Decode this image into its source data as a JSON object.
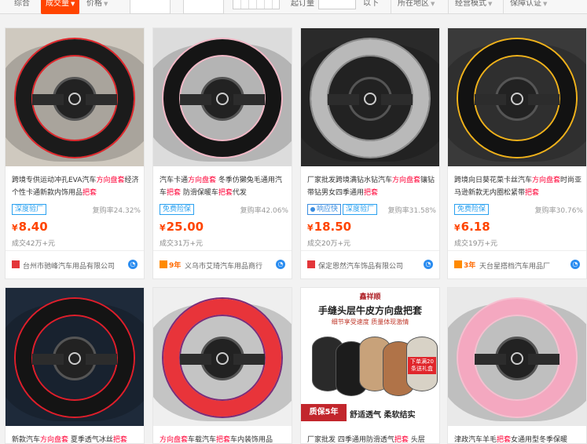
{
  "sortbar": {
    "comprehensive": "综合",
    "sales": "成交量",
    "price": "价格",
    "input_placeholder_1": "",
    "input_placeholder_2": "",
    "shipping_from": "起订量",
    "low_price": "以下",
    "location": "所在地区",
    "mode": "经营模式",
    "guarantee": "保障认证"
  },
  "products": [
    {
      "title_pre": "跨境专供运动冲孔EVA汽车",
      "title_hl": "方向盘套",
      "title_mid": "经济个性卡通新款内饰用品",
      "title_hl2": "把套",
      "tags": [
        "深度验厂"
      ],
      "repurchase": "复购率24.32%",
      "price": "8.40",
      "sold": "成交42万+元",
      "years": "",
      "shop": "台州市驰峰汽车用品有限公司",
      "img_bg": "#cfc9bf",
      "ring_color": "#1b1b1b",
      "accent": "#e0262b"
    },
    {
      "title_pre": "汽车卡通",
      "title_hl": "方向盘套",
      "title_mid": " 冬季仿獭兔毛通用汽车",
      "title_hl2": "把套",
      "title_post": " 防滑保暖车",
      "title_hl3": "把套",
      "title_post2": "代发",
      "tags": [
        "免费险保"
      ],
      "repurchase": "复购率42.06%",
      "price": "25.00",
      "sold": "成交31万+元",
      "years": "9年",
      "shop": "义乌市艾琦汽车用品商行",
      "img_bg": "#dcdcdc",
      "ring_color": "#151515",
      "accent": "#f2b8c6"
    },
    {
      "title_pre": "厂家批发跨境满钻水钻汽车",
      "title_hl": "方向盘套",
      "title_mid": "镶钻带钻男女四季通用",
      "title_hl2": "把套",
      "tags": [
        "响应快",
        "深度验厂"
      ],
      "repurchase": "复购率31.58%",
      "price": "18.50",
      "sold": "成交20万+元",
      "years": "",
      "shop": "保定恩然汽车饰品有限公司",
      "img_bg": "#2a2a2a",
      "ring_color": "#b9b9b9",
      "accent": "#8c8c8c"
    },
    {
      "title_pre": "跨境向日葵花菜卡丝汽车",
      "title_hl": "方向盘套",
      "title_mid": "时尚亚马逊新款无内圈松紧带",
      "title_hl2": "把套",
      "tags": [
        "免费险保"
      ],
      "repurchase": "复购率30.76%",
      "price": "6.18",
      "sold": "成交19万+元",
      "years": "3年",
      "shop": "天台星搭档汽车用品厂",
      "img_bg": "#3a3a3a",
      "ring_color": "#121212",
      "accent": "#f0b21a"
    },
    {
      "title_pre": "新款汽车",
      "title_hl": "方向盘套",
      "title_mid": " 夏季透气冰丝",
      "title_hl2": "把套",
      "tags": [],
      "repurchase": "",
      "price": "",
      "sold": "",
      "years": "",
      "shop": "",
      "img_bg": "#1e2a3a",
      "ring_color": "#141414",
      "accent": "#e01e2a"
    },
    {
      "title_pre": "",
      "title_hl": "方向盘套",
      "title_mid": "车载汽车",
      "title_hl2": "把套",
      "title_post": "车内装饰用品",
      "tags": [],
      "repurchase": "",
      "price": "",
      "sold": "",
      "years": "",
      "shop": "",
      "img_bg": "#efefef",
      "ring_color": "#e8343a",
      "accent": "#7a2c7a"
    },
    {
      "title_pre": "厂家批发 四季通用防滑透气",
      "title_hl": "把套",
      "title_mid": " 头层",
      "tags": [],
      "repurchase": "",
      "price": "",
      "sold": "",
      "years": "",
      "shop": "",
      "img_bg": "#ffffff",
      "ring_color": "#222222",
      "accent": "#c8a27a",
      "banner": {
        "brand": "鑫祥顺",
        "headline": "手缝头层牛皮方向盘把套",
        "sub": "细节享受速度 质量体现激情",
        "badge1": "质保5年",
        "badge2": "舒适透气  柔软结实",
        "promo": "下单满20条送礼盒"
      }
    },
    {
      "title_pre": "津政汽车羊毛",
      "title_hl": "把套",
      "title_mid": "女通用型冬季保暖",
      "tags": [],
      "repurchase": "",
      "price": "",
      "sold": "",
      "years": "",
      "shop": "",
      "img_bg": "#e9e9e9",
      "ring_color": "#f4a8c0",
      "accent": "#f7bfd0"
    }
  ]
}
